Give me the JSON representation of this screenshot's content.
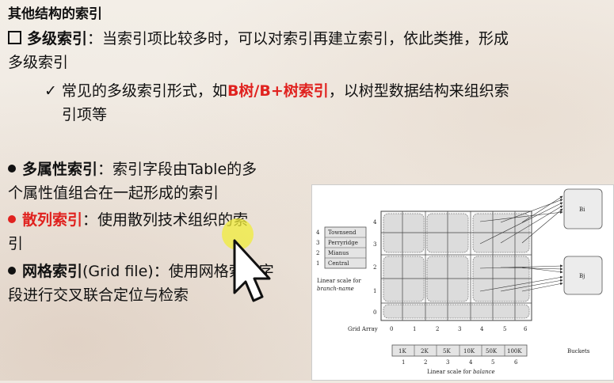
{
  "slide": {
    "title": "其他结构的索引",
    "multilevel": {
      "term": "多级索引",
      "line1": "：当索引项比较多时，可以对索引再建立索引，依此类推，形成",
      "line2": "多级索引",
      "sub_pre": "常见的多级索引形式，如",
      "sub_highlight": "B树/B+树索引",
      "sub_post": "，以树型数据结构来组织索",
      "sub_line2": "引项等"
    },
    "multiattr": {
      "term": "多属性索引",
      "line1": "：索引字段由Table的多",
      "line2": "个属性值组合在一起形成的索引"
    },
    "hash": {
      "term": "散列索引",
      "line1": "：使用散列技术组织的索",
      "line2": "引"
    },
    "grid": {
      "term": "网格索引",
      "line1": "(Grid file)：使用网格索引字",
      "line2": "段进行交叉联合定位与检索"
    }
  },
  "diagram": {
    "branch_scale_numbers": [
      "4",
      "3",
      "2",
      "1"
    ],
    "branch_scale_names": [
      "Townsend",
      "Perryridge",
      "Mianus",
      "Central"
    ],
    "branch_scale_caption1": "Linear scale for",
    "branch_scale_caption2": "branch-name",
    "row_labels": [
      "4",
      "3",
      "2",
      "1",
      "0"
    ],
    "col_labels": [
      "0",
      "1",
      "2",
      "3",
      "4",
      "5",
      "6"
    ],
    "grid_array_label": "Grid Array",
    "buckets": [
      "Bi",
      "Bj"
    ],
    "buckets_label": "Buckets",
    "balance_scale_values": [
      "1K",
      "2K",
      "5K",
      "10K",
      "50K",
      "100K"
    ],
    "balance_scale_numbers": [
      "1",
      "2",
      "3",
      "4",
      "5",
      "6"
    ],
    "balance_scale_caption_prefix": "Linear scale for ",
    "balance_scale_caption_em": "balance"
  },
  "colors": {
    "highlight": "#e0221f",
    "cursor_glow": "#f0ec3a"
  }
}
